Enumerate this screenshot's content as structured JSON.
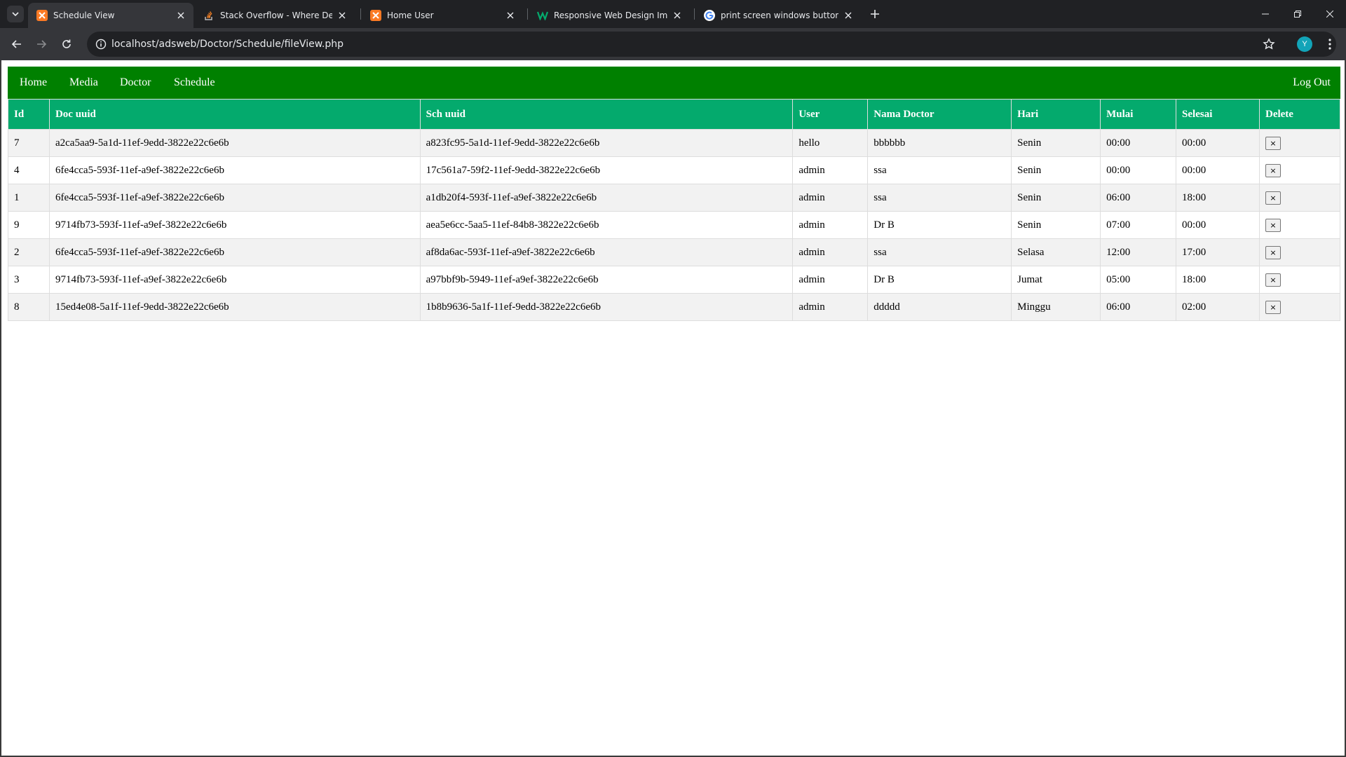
{
  "browser": {
    "tabs": [
      {
        "title": "Schedule View",
        "icon": "xampp-icon",
        "active": true
      },
      {
        "title": "Stack Overflow - Where Develo",
        "icon": "stackoverflow-icon",
        "active": false
      },
      {
        "title": "Home User",
        "icon": "xampp-icon",
        "active": false
      },
      {
        "title": "Responsive Web Design Images",
        "icon": "w3schools-icon",
        "active": false
      },
      {
        "title": "print screen windows button - G",
        "icon": "google-icon",
        "active": false
      }
    ],
    "url": "localhost/adsweb/Doctor/Schedule/fileView.php",
    "profile_initial": "Y"
  },
  "nav": {
    "home": "Home",
    "media": "Media",
    "doctor": "Doctor",
    "schedule": "Schedule",
    "logout": "Log Out"
  },
  "table": {
    "headers": [
      "Id",
      "Doc uuid",
      "Sch uuid",
      "User",
      "Nama Doctor",
      "Hari",
      "Mulai",
      "Selesai",
      "Delete"
    ],
    "rows": [
      {
        "id": "7",
        "doc_uuid": "a2ca5aa9-5a1d-11ef-9edd-3822e22c6e6b",
        "sch_uuid": "a823fc95-5a1d-11ef-9edd-3822e22c6e6b",
        "user": "hello",
        "doctor": "bbbbbb",
        "hari": "Senin",
        "mulai": "00:00",
        "selesai": "00:00"
      },
      {
        "id": "4",
        "doc_uuid": "6fe4cca5-593f-11ef-a9ef-3822e22c6e6b",
        "sch_uuid": "17c561a7-59f2-11ef-9edd-3822e22c6e6b",
        "user": "admin",
        "doctor": "ssa",
        "hari": "Senin",
        "mulai": "00:00",
        "selesai": "00:00"
      },
      {
        "id": "1",
        "doc_uuid": "6fe4cca5-593f-11ef-a9ef-3822e22c6e6b",
        "sch_uuid": "a1db20f4-593f-11ef-a9ef-3822e22c6e6b",
        "user": "admin",
        "doctor": "ssa",
        "hari": "Senin",
        "mulai": "06:00",
        "selesai": "18:00"
      },
      {
        "id": "9",
        "doc_uuid": "9714fb73-593f-11ef-a9ef-3822e22c6e6b",
        "sch_uuid": "aea5e6cc-5aa5-11ef-84b8-3822e22c6e6b",
        "user": "admin",
        "doctor": "Dr B",
        "hari": "Senin",
        "mulai": "07:00",
        "selesai": "00:00"
      },
      {
        "id": "2",
        "doc_uuid": "6fe4cca5-593f-11ef-a9ef-3822e22c6e6b",
        "sch_uuid": "af8da6ac-593f-11ef-a9ef-3822e22c6e6b",
        "user": "admin",
        "doctor": "ssa",
        "hari": "Selasa",
        "mulai": "12:00",
        "selesai": "17:00"
      },
      {
        "id": "3",
        "doc_uuid": "9714fb73-593f-11ef-a9ef-3822e22c6e6b",
        "sch_uuid": "a97bbf9b-5949-11ef-a9ef-3822e22c6e6b",
        "user": "admin",
        "doctor": "Dr B",
        "hari": "Jumat",
        "mulai": "05:00",
        "selesai": "18:00"
      },
      {
        "id": "8",
        "doc_uuid": "15ed4e08-5a1f-11ef-9edd-3822e22c6e6b",
        "sch_uuid": "1b8b9636-5a1f-11ef-9edd-3822e22c6e6b",
        "user": "admin",
        "doctor": "ddddd",
        "hari": "Minggu",
        "mulai": "06:00",
        "selesai": "02:00"
      }
    ],
    "delete_label": "×"
  },
  "colors": {
    "nav_bg": "#008000",
    "header_bg": "#04aa6d",
    "row_alt": "#f2f2f2"
  }
}
